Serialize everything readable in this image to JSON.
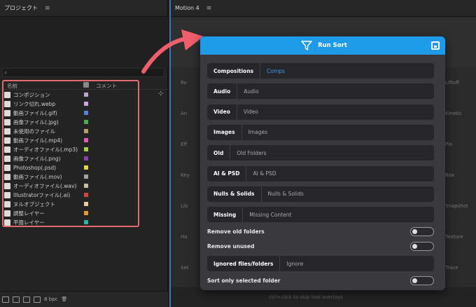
{
  "project_panel": {
    "title": "プロジェクト",
    "columns": {
      "name": "名前",
      "comment": "コメント"
    },
    "items": [
      {
        "label": "コンポジション",
        "icon": "composition-icon",
        "color": "#b9a7c9"
      },
      {
        "label": "リンク切れ.webp",
        "icon": "missing-footage-icon",
        "color": "#c6a8d9"
      },
      {
        "label": "動画ファイル(.gif)",
        "icon": "gif-file-icon",
        "color": "#5b7fe0"
      },
      {
        "label": "画像ファイル(.jpg)",
        "icon": "jpg-file-icon",
        "color": "#47b04a"
      },
      {
        "label": "未使用のファイル",
        "icon": "unused-file-icon",
        "color": "#b3a36b"
      },
      {
        "label": "動画ファイル(.mp4)",
        "icon": "mp4-file-icon",
        "color": "#e35bb7"
      },
      {
        "label": "オーディオファイル(.mp3)",
        "icon": "audio-file-icon",
        "color": "#a3d34b"
      },
      {
        "label": "画像ファイル(.png)",
        "icon": "png-file-icon",
        "color": "#8a3fb6"
      },
      {
        "label": "Photoshop(.psd)",
        "icon": "psd-file-icon",
        "color": "#e3d84b"
      },
      {
        "label": "動画ファイル(.mov)",
        "icon": "mov-file-icon",
        "color": "#a3a3a3"
      },
      {
        "label": "オーディオファイル(.wav)",
        "icon": "wav-file-icon",
        "color": "#c8bfa3"
      },
      {
        "label": "Illustratorファイル(.ai)",
        "icon": "ai-file-icon",
        "color": "#d0463c"
      },
      {
        "label": "ヌルオブジェクト",
        "icon": "null-object-icon",
        "color": "#f0c8a0"
      },
      {
        "label": "調整レイヤー",
        "icon": "adjustment-layer-icon",
        "color": "#e8962f"
      },
      {
        "label": "平面レイヤー",
        "icon": "solid-layer-icon",
        "color": "#2fb3a8"
      }
    ],
    "footer": {
      "bpc": "8 bpc"
    }
  },
  "motion_panel": {
    "title": "Motion 4",
    "side_left": [
      "Ro",
      "An",
      "Eff",
      "Key",
      "Lib",
      "Ho",
      "Set"
    ],
    "side_right": [
      "Liftoff",
      "Kinetic",
      "Pin",
      "Box",
      "Snapshot",
      "Texture",
      "Trace"
    ],
    "hint": "ctrl+click to skip tool overlays"
  },
  "dialog": {
    "run_label": "Run Sort",
    "fields": [
      {
        "label": "Compositions",
        "value": "Comps",
        "accent": true
      },
      {
        "label": "Audio",
        "value": "Audio",
        "accent": false
      },
      {
        "label": "Video",
        "value": "Video",
        "accent": false
      },
      {
        "label": "Images",
        "value": "Images",
        "accent": false
      },
      {
        "label": "Old",
        "value": "Old Folders",
        "accent": false
      },
      {
        "label": "AI & PSD",
        "value": "AI & PSD",
        "accent": false
      },
      {
        "label": "Nulls & Solids",
        "value": "Nulls & Solids",
        "accent": false
      },
      {
        "label": "Missing",
        "value": "Missing Content",
        "accent": false
      }
    ],
    "toggles": {
      "remove_old_folders": {
        "label": "Remove old folders",
        "on": false
      },
      "remove_unused": {
        "label": "Remove unused",
        "on": false
      },
      "sort_only_selected": {
        "label": "Sort only selected folder",
        "on": false
      }
    },
    "ignored": {
      "label": "Ignored files/folders",
      "value": "Ignore"
    }
  }
}
